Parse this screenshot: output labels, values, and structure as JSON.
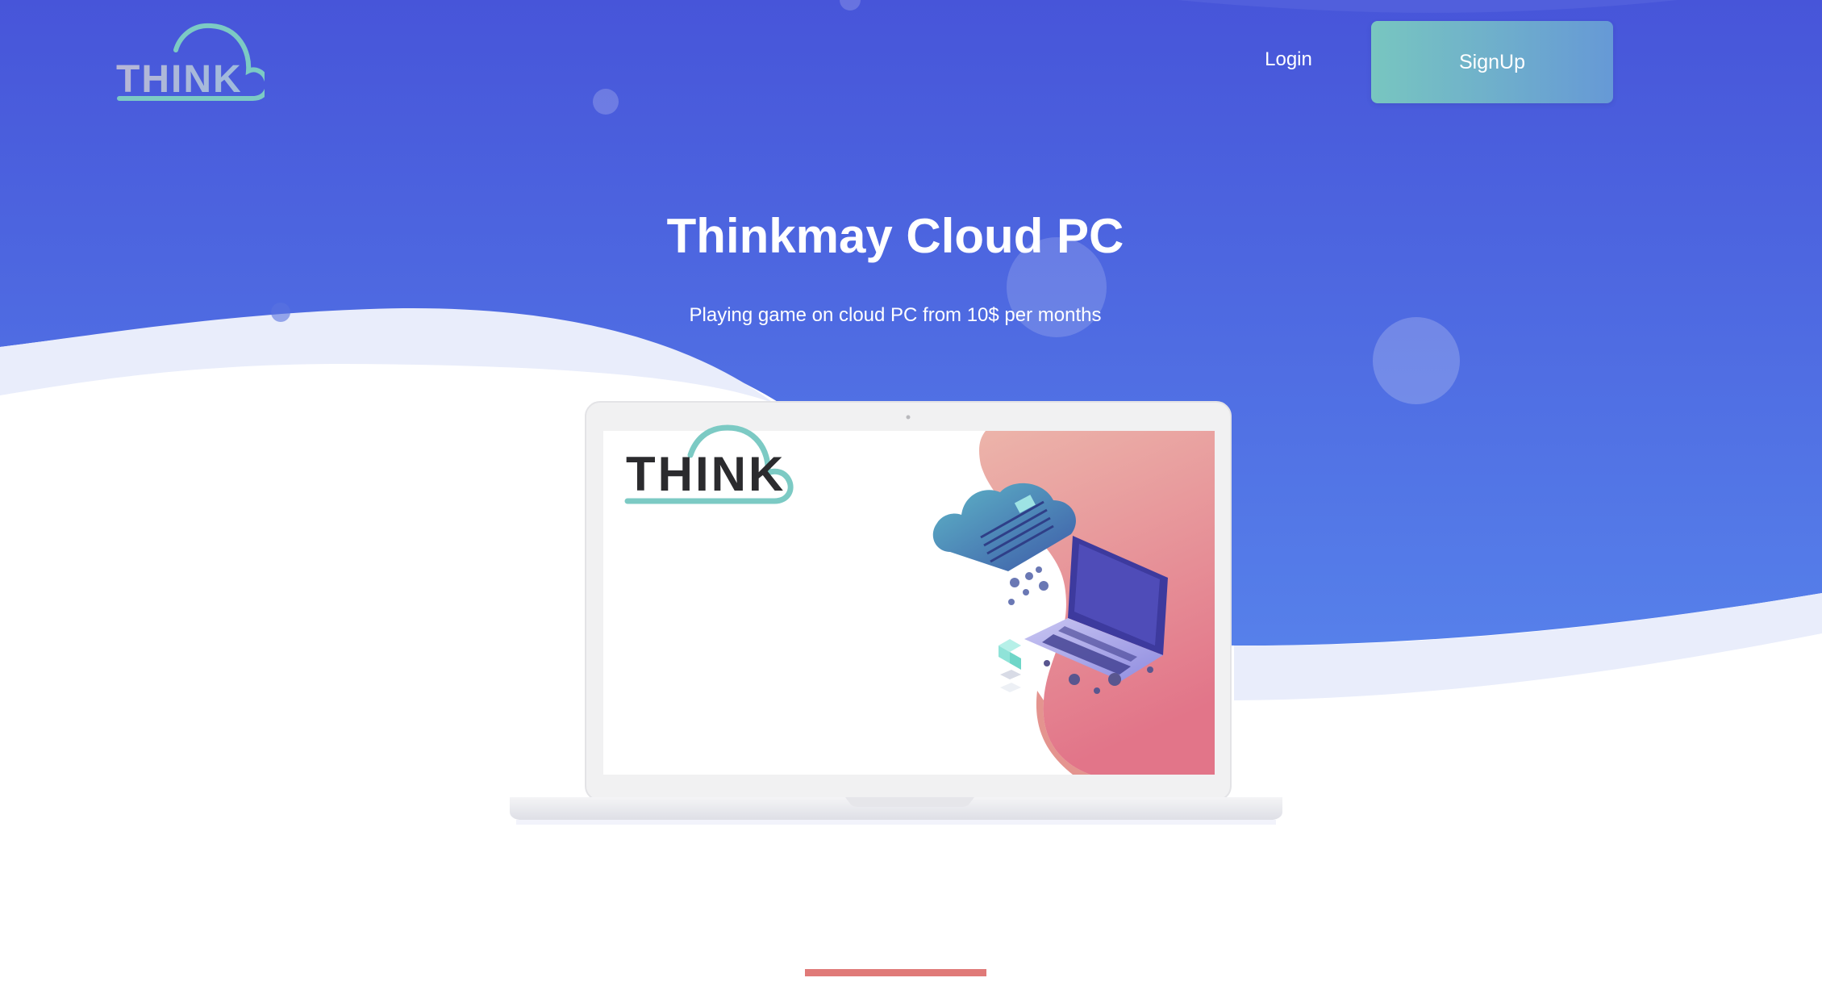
{
  "header": {
    "logo_text": "THINK",
    "login_label": "Login",
    "signup_label": "SignUp"
  },
  "hero": {
    "title": "Thinkmay Cloud PC",
    "subtitle": "Playing game on cloud PC from 10$ per months"
  },
  "screen": {
    "logo_text": "THINK"
  },
  "colors": {
    "hero_gradient_top": "#4755d9",
    "hero_gradient_bottom": "#5577e8",
    "signup_gradient_start": "#78c6c0",
    "signup_gradient_end": "#6699d6",
    "accent": "#e07a78",
    "logo_teal": "#7ccac4"
  }
}
